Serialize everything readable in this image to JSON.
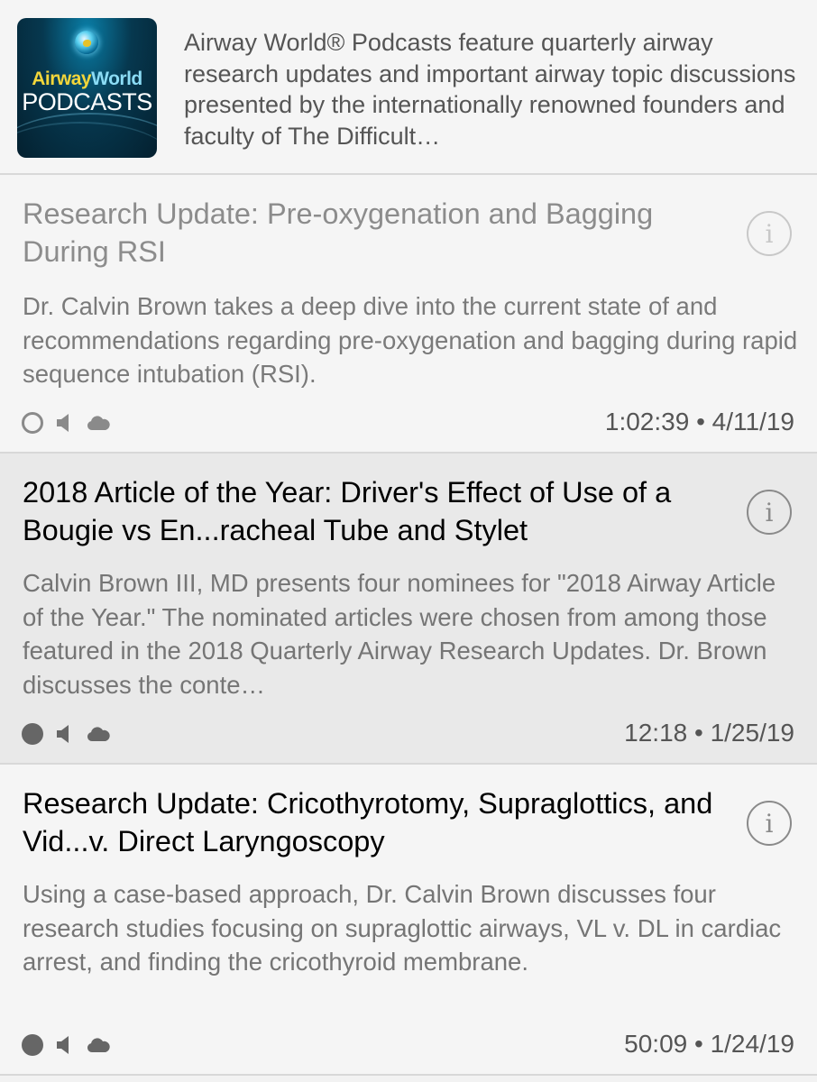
{
  "show": {
    "artwork": {
      "line1_a": "Airway",
      "line1_b": "World",
      "line2": "PODCASTS",
      "colors": {
        "gold": "#f3d63a",
        "cyan": "#8bdcf5",
        "background": "#06384f"
      }
    },
    "description": "Airway World® Podcasts feature quarterly airway research updates and important airway topic discussions presented by the internationally renowned founders and faculty of The Difficult…"
  },
  "episodes": [
    {
      "title": "Research Update: Pre-oxygenation and Bagging During RSI",
      "description": "Dr. Calvin Brown takes a deep dive into the current state of and recommendations regarding pre-oxygenation and bagging during rapid sequence intubation (RSI).",
      "duration": "1:02:39",
      "separator": "•",
      "date": "4/11/19",
      "meta": "1:02:39 • 4/11/19",
      "played": true,
      "icons": [
        "unplayed-circle-icon",
        "speaker-icon",
        "cloud-icon"
      ]
    },
    {
      "title": "2018 Article of the Year: Driver's Effect of Use of a Bougie vs En...racheal Tube and Stylet",
      "description": "Calvin Brown III, MD presents four nominees for \"2018 Airway Article of the Year.\"  The nominated articles were chosen from among those featured in the 2018 Quarterly Airway Research Updates.  Dr. Brown discusses the conte…",
      "duration": "12:18",
      "separator": "•",
      "date": "1/25/19",
      "meta": "12:18 • 1/25/19",
      "played": false,
      "icons": [
        "unplayed-dot-icon",
        "speaker-icon",
        "cloud-icon"
      ]
    },
    {
      "title": "Research Update: Cricothyrotomy, Supraglottics, and Vid...v. Direct Laryngoscopy",
      "description": "Using a case-based approach, Dr. Calvin Brown discusses four research studies focusing on supraglottic airways, VL v. DL in cardiac arrest, and finding the cricothyroid membrane.",
      "duration": "50:09",
      "separator": "•",
      "date": "1/24/19",
      "meta": "50:09 • 1/24/19",
      "played": false,
      "icons": [
        "unplayed-dot-icon",
        "speaker-icon",
        "cloud-icon"
      ]
    }
  ],
  "info_glyph": "i"
}
